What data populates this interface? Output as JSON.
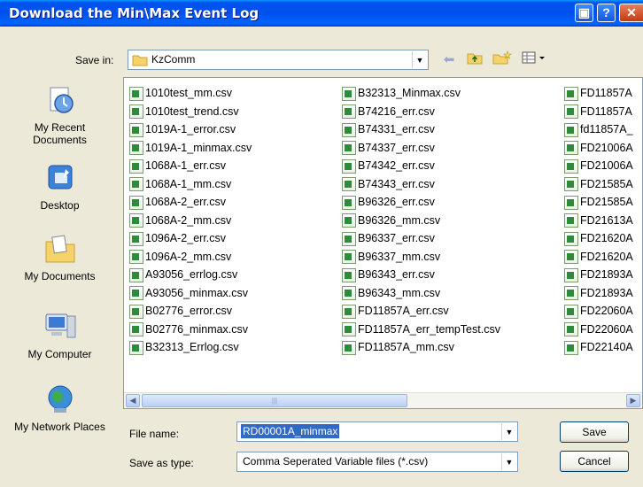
{
  "window": {
    "title": "Download the Min\\Max Event Log"
  },
  "save_in": {
    "label": "Save in:",
    "value": "KzComm"
  },
  "places": [
    {
      "label": "My Recent Documents",
      "icon": "recent-documents-icon"
    },
    {
      "label": "Desktop",
      "icon": "desktop-icon"
    },
    {
      "label": "My Documents",
      "icon": "my-documents-icon"
    },
    {
      "label": "My Computer",
      "icon": "my-computer-icon"
    },
    {
      "label": "My Network Places",
      "icon": "network-places-icon"
    }
  ],
  "files": {
    "col1": [
      "1010test_mm.csv",
      "1010test_trend.csv",
      "1019A-1_error.csv",
      "1019A-1_minmax.csv",
      "1068A-1_err.csv",
      "1068A-1_mm.csv",
      "1068A-2_err.csv",
      "1068A-2_mm.csv",
      "1096A-2_err.csv",
      "1096A-2_mm.csv",
      "A93056_errlog.csv",
      "A93056_minmax.csv",
      "B02776_error.csv",
      "B02776_minmax.csv",
      "B32313_Errlog.csv"
    ],
    "col2": [
      "B32313_Minmax.csv",
      "B74216_err.csv",
      "B74331_err.csv",
      "B74337_err.csv",
      "B74342_err.csv",
      "B74343_err.csv",
      "B96326_err.csv",
      "B96326_mm.csv",
      "B96337_err.csv",
      "B96337_mm.csv",
      "B96343_err.csv",
      "B96343_mm.csv",
      "FD11857A_err.csv",
      "FD11857A_err_tempTest.csv",
      "FD11857A_mm.csv"
    ],
    "col3": [
      "FD11857A",
      "FD11857A",
      "fd11857A_",
      "FD21006A",
      "FD21006A",
      "FD21585A",
      "FD21585A",
      "FD21613A",
      "FD21620A",
      "FD21620A",
      "FD21893A",
      "FD21893A",
      "FD22060A",
      "FD22060A",
      "FD22140A"
    ]
  },
  "file_name": {
    "label": "File name:",
    "value": "RD00001A_minmax"
  },
  "save_type": {
    "label": "Save as type:",
    "value": "Comma Seperated Variable files (*.csv)"
  },
  "buttons": {
    "save": "Save",
    "cancel": "Cancel",
    "help": "?",
    "minimize": "▣",
    "close": "✕"
  },
  "colors": {
    "title_bar": "#0053EE",
    "dialog_bg": "#ECE9D8",
    "selection": "#316AC5"
  }
}
